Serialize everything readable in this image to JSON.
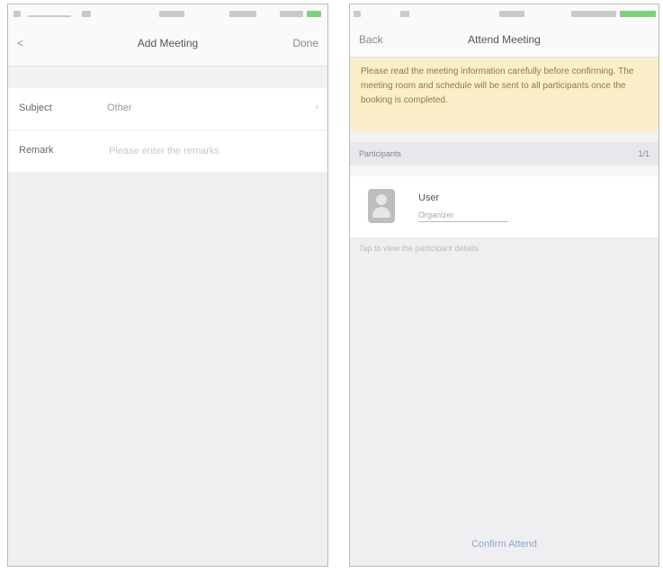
{
  "left_screen": {
    "nav": {
      "back": "<",
      "title": "Add Meeting",
      "right": "Done"
    },
    "form": {
      "rows": [
        {
          "label": "Subject",
          "value": "Other"
        },
        {
          "label": "Remark",
          "placeholder": "Please enter the remarks"
        }
      ]
    }
  },
  "right_screen": {
    "nav": {
      "back": "Back",
      "title": "Attend Meeting"
    },
    "notice": "Please read the meeting information carefully before confirming. The meeting room and schedule will be sent to all participants once the booking is completed.",
    "section": {
      "left": "Participants",
      "right": "1/1"
    },
    "contact": {
      "name": "User",
      "sub": "Organizer"
    },
    "caption": "Tap to view the participant details",
    "bottom_action": "Confirm Attend"
  },
  "colors": {
    "notice_bg": "#fbefc9",
    "accent": "#8aa7cf",
    "signal_green": "#7cd27c"
  }
}
